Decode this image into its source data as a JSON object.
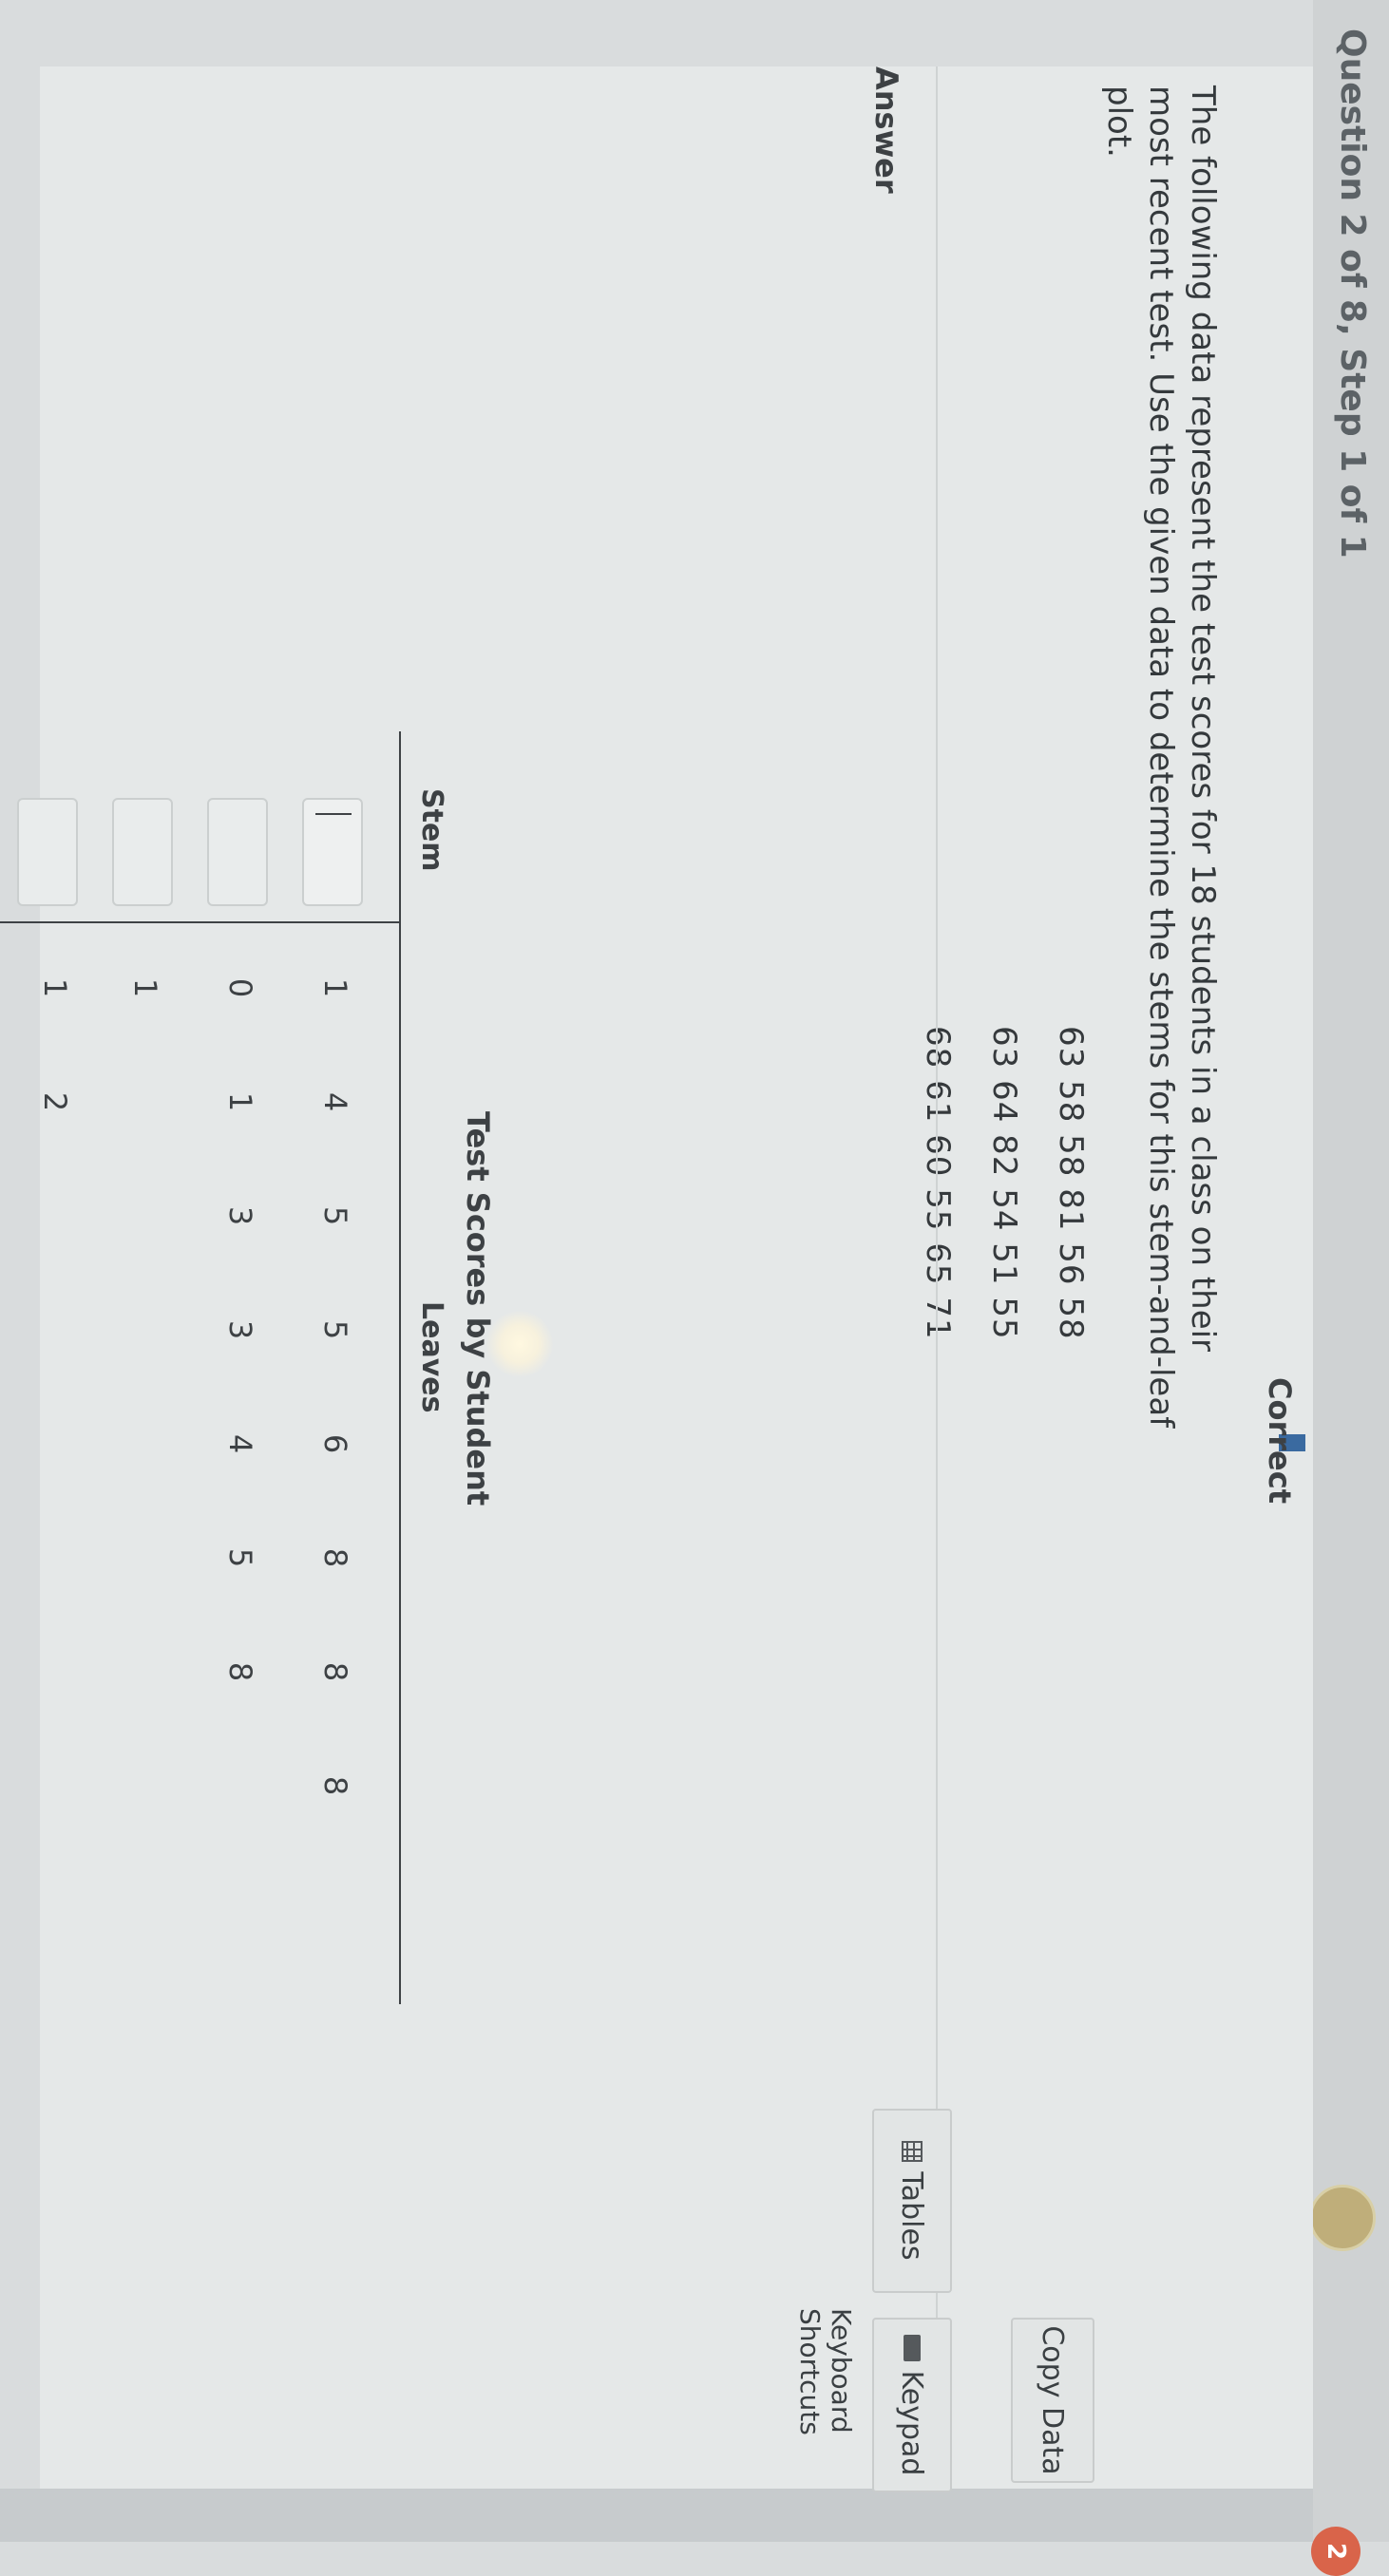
{
  "header": {
    "breadcrumb": "Question 2 of 8, Step 1 of 1",
    "status": "Correct",
    "user_badge": "2"
  },
  "question": {
    "prompt": "The following data represent the test scores for 18 students in a class on their most recent test. Use the given data to determine the stems for this stem-and-leaf plot.",
    "data_rows": [
      "63  58  58  81  56  58",
      "63  64  82  54  51  55",
      "68  61  60  55  65  71"
    ],
    "copy_data_label": "Copy Data"
  },
  "answer": {
    "label": "Answer",
    "tables_label": "Tables",
    "keypad_label": "Keypad",
    "shortcuts_label": "Keyboard Shortcuts"
  },
  "plot": {
    "title": "Test Scores by Student",
    "stem_header": "Stem",
    "leaves_header": "Leaves",
    "rows": [
      {
        "stem_value": "",
        "leaves": [
          "1",
          "4",
          "5",
          "5",
          "6",
          "8",
          "8",
          "8"
        ]
      },
      {
        "stem_value": "",
        "leaves": [
          "0",
          "1",
          "3",
          "3",
          "4",
          "5",
          "8"
        ]
      },
      {
        "stem_value": "",
        "leaves": [
          "1"
        ]
      },
      {
        "stem_value": "",
        "leaves": [
          "1",
          "2"
        ]
      }
    ]
  },
  "icons": {
    "tables": "grid-icon",
    "keypad": "keypad-icon"
  },
  "colors": {
    "status_bar": "#3a6aa0",
    "user_badge": "#d9644a"
  }
}
